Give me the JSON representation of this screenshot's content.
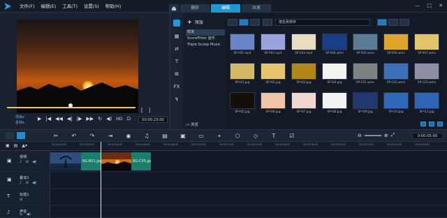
{
  "menu": [
    "文件(F)",
    "编辑(E)",
    "工具(T)",
    "设置(S)",
    "帮助(H)"
  ],
  "tabs": {
    "home_icon": "home-icon",
    "items": [
      "捕获",
      "编辑",
      "共享"
    ],
    "active": "编辑"
  },
  "window_controls": [
    "—",
    "□",
    "✕"
  ],
  "preview": {
    "brackets": [
      "[",
      "]"
    ],
    "mode_labels": [
      "项目▾",
      "素材▾"
    ],
    "controls": [
      "▶",
      "|◀",
      "◀◀",
      "◀|",
      "|▶",
      "▶▶",
      "↻",
      "◀)",
      "HD",
      "⊡"
    ],
    "timecode": "00:00:23:00"
  },
  "library": {
    "add_label": "添加",
    "items": [
      "样本",
      "ScoreFitter 音乐",
      "Triple Scoop Music"
    ],
    "selected": 0,
    "browse_label": "浏览",
    "sort_label": "按名称排序",
    "side_icons": [
      "media-icon",
      "instant-project-icon",
      "transition-icon",
      "title-icon",
      "graphics-icon",
      "fx-icon",
      "path-icon"
    ],
    "side_glyphs": [
      "",
      "▦",
      "⇄",
      "T",
      "⊞",
      "FX",
      "↯"
    ],
    "thumbnails": [
      {
        "caption": "SP-V01.mp4",
        "color": "#6a86c9"
      },
      {
        "caption": "SP-V02.mp4",
        "color": "#9aa2e0"
      },
      {
        "caption": "SP-V03.mp4",
        "color": "#e9ddc0"
      },
      {
        "caption": "SP-V04.wmv",
        "color": "#1a3d8a"
      },
      {
        "caption": "SP-V05.wmv",
        "color": "#5a7c94"
      },
      {
        "caption": "SP-V06.wmv",
        "color": "#e0a62c"
      },
      {
        "caption": "SP-V07.wmv",
        "color": "#e5c46a"
      },
      {
        "caption": "SP-I01.jpg",
        "color": "#d6b866"
      },
      {
        "caption": "SP-I02.jpg",
        "color": "#e7c46d"
      },
      {
        "caption": "SP-I03.jpg",
        "color": "#b28618"
      },
      {
        "caption": "SP-I04.jpg",
        "color": "#f2f2ee"
      },
      {
        "caption": "SP-C01.wmv",
        "color": "#7d8282"
      },
      {
        "caption": "SP-C02.wmv",
        "color": "#3c6fb7"
      },
      {
        "caption": "SP-C03.wmv",
        "color": "#8d8fa4"
      },
      {
        "caption": "SP-I05.jpg",
        "color": "#150e0b"
      },
      {
        "caption": "SP-I06.jpg",
        "color": "#f0c6a6"
      },
      {
        "caption": "SP-I07.jpg",
        "color": "#f2d6d0"
      },
      {
        "caption": "SP-I08.jpg",
        "color": "#f3f3f3"
      },
      {
        "caption": "SP-I09.jpg",
        "color": "#1f3870"
      },
      {
        "caption": "SP-I10.jpg",
        "color": "#2f69b8"
      },
      {
        "caption": "SP-I11.jpg",
        "color": "#2e64b3"
      }
    ]
  },
  "timeline": {
    "tool_icons": [
      "tools-icon",
      "undo-icon",
      "redo-icon",
      "trim-icon",
      "record-icon",
      "mixer-icon",
      "auto-music-icon",
      "motion-icon",
      "subtitle-icon",
      "mask-icon",
      "3d-icon",
      "multicam-icon",
      "title-icon",
      "check-icon"
    ],
    "tool_glyphs": [
      "✂",
      "↶",
      "↷",
      "⇥",
      "◉",
      "♫",
      "▤",
      "▣",
      "▭",
      "⌖",
      "⬡",
      "◇",
      "T",
      "☑"
    ],
    "zoom_glyphs": [
      "⊖",
      "⊕",
      "⤢"
    ],
    "time": "0:00:05:00",
    "ruler_head": [
      "▣",
      "▤",
      "▲▾"
    ],
    "ruler_marks": [
      "00:00:00:00",
      "00:00:02:00",
      "00:00:04:00",
      "00:00:06:00",
      "00:00:08:00",
      "00:00:10:00",
      "00:00:12:00",
      "00:00:14:00",
      "00:00:16:00",
      "00:00:18:00",
      "00:00:20:00",
      "00:00:22:00",
      "00:00:24:00",
      "00:00:26:00"
    ],
    "tracks": [
      {
        "name": "视频",
        "icon": "▣",
        "ctl": [
          "♪",
          "⊘",
          "◀)"
        ]
      },
      {
        "name": "叠加1",
        "icon": "▣",
        "ctl": [
          "♪",
          "⊘",
          "◀)"
        ]
      },
      {
        "name": "标题1",
        "icon": "T",
        "ctl": [
          "⊘"
        ]
      },
      {
        "name": "声音",
        "icon": "♪",
        "ctl": [
          "⊘",
          "◀)"
        ]
      }
    ],
    "clips": [
      {
        "label": "BG-B01.jpg",
        "color": "#1c7f6a"
      },
      {
        "label": "BG-C05.jpg",
        "color": "#1c7f6a"
      }
    ]
  }
}
